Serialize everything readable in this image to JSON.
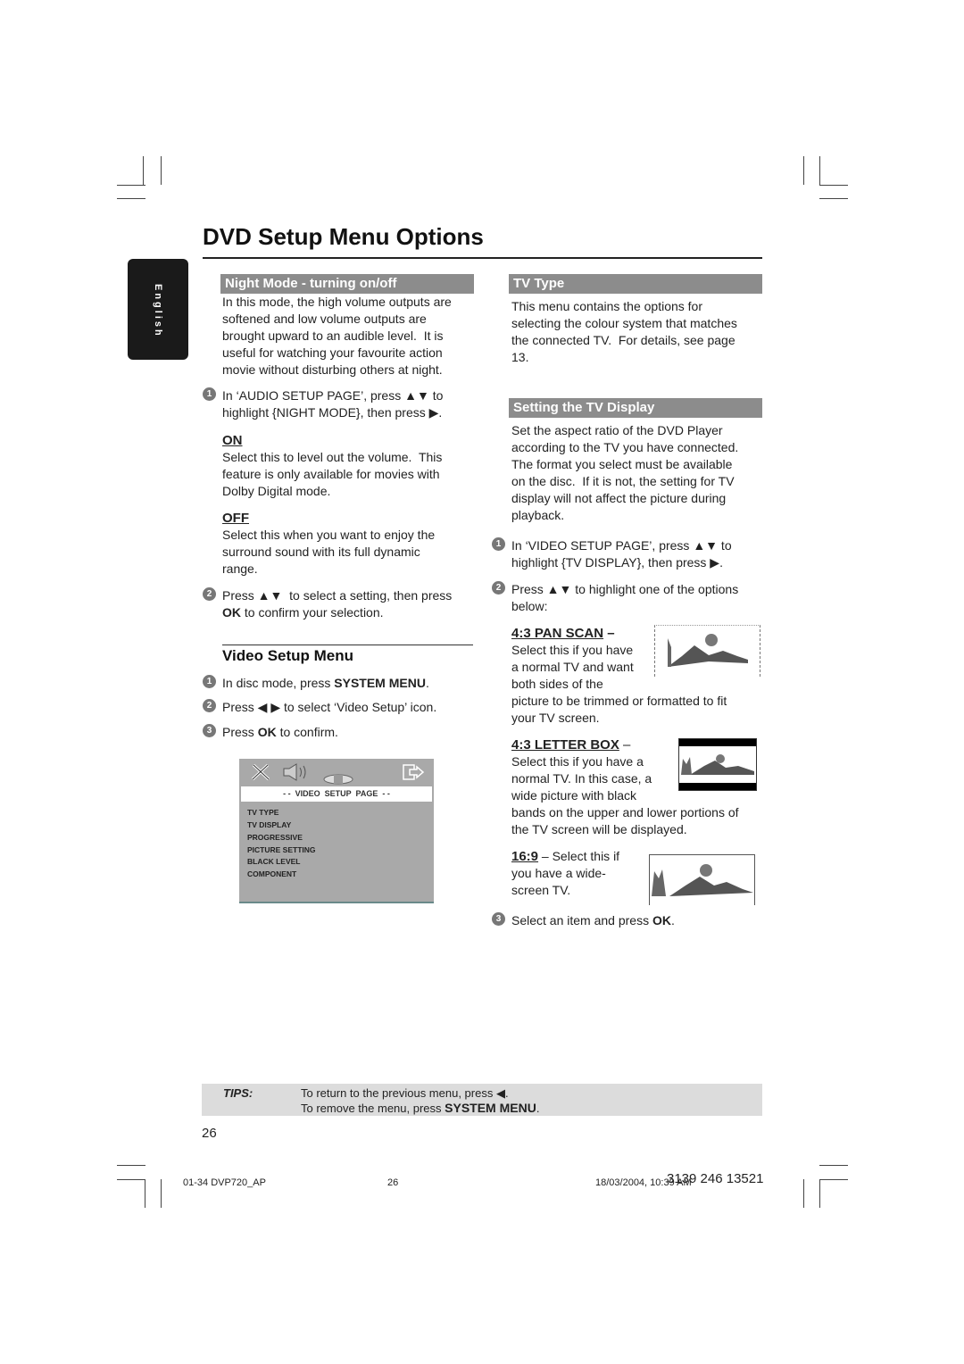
{
  "title": "DVD Setup Menu Options",
  "language_tab": "English",
  "left": {
    "night_mode": {
      "header": "Night Mode - turning on/off",
      "intro": "In this mode, the high volume outputs are\nsoftened and low volume outputs are\nbrought upward to an audible level.  It is\nuseful for watching your favourite action\nmovie without disturbing others at night.",
      "step1": {
        "num": "1",
        "text": "In ‘AUDIO SETUP PAGE’, press ▲▼ to\nhighlight {NIGHT MODE}, then press ▶."
      },
      "on": {
        "label": "ON",
        "text": "Select this to level out the volume.  This\nfeature is only available for movies with\nDolby Digital mode."
      },
      "off": {
        "label": "OFF",
        "text": "Select this when you want to enjoy the\nsurround sound with its full dynamic\nrange."
      },
      "step2": {
        "num": "2",
        "line1": "Press ▲▼  to select a setting, then press",
        "bold": "OK",
        "line2_rest": " to confirm your selection."
      }
    },
    "video_setup": {
      "heading": "Video Setup Menu",
      "step1": {
        "num": "1",
        "pre": "In disc mode, press ",
        "bold": "SYSTEM MENU",
        "post": "."
      },
      "step2": {
        "num": "2",
        "text": "Press ◀ ▶ to select ‘Video Setup’ icon."
      },
      "step3": {
        "num": "3",
        "pre": "Press ",
        "bold": "OK",
        "post": " to confirm."
      }
    },
    "menu_screen": {
      "header": "- -  VIDEO  SETUP  PAGE  - -",
      "items": [
        "TV TYPE",
        "TV DISPLAY",
        "PROGRESSIVE",
        "PICTURE SETTING",
        "BLACK LEVEL",
        "COMPONENT"
      ],
      "icons": [
        "tools-icon",
        "speaker-icon",
        "disc-icon",
        "exit-icon"
      ]
    }
  },
  "right": {
    "tv_type": {
      "header": "TV Type",
      "text": "This menu contains the options for\nselecting the colour system that matches\nthe connected TV.  For details, see page\n13."
    },
    "tv_display": {
      "header": "Setting the TV Display",
      "intro": "Set the aspect ratio of the DVD Player\naccording to the TV you have connected.\nThe format you select must be available\non the disc.  If it is not, the setting for TV\ndisplay will not affect the picture during\nplayback.",
      "step1": {
        "num": "1",
        "text": "In ‘VIDEO SETUP PAGE’, press ▲▼ to\nhighlight {TV DISPLAY}, then press ▶."
      },
      "step2": {
        "num": "2",
        "text": "Press ▲▼ to highlight one of the options\nbelow:"
      },
      "pan_scan": {
        "label": "4:3 PAN SCAN",
        "dash": " –",
        "text_narrow": "Select this if you have\na normal TV and want\nboth sides of the",
        "text_wide": "picture to be trimmed or formatted to fit\nyour TV screen."
      },
      "letter_box": {
        "label": "4:3 LETTER BOX",
        "dash": " –",
        "text_narrow": "Select this if you have a\nnormal TV. In this case, a\nwide picture with black",
        "text_wide": "bands on the upper and lower portions of\nthe TV screen will be displayed."
      },
      "wide": {
        "label": "16:9",
        "rest": " – Select this if",
        "text": "you have a wide-\nscreen TV."
      },
      "step3": {
        "num": "3",
        "pre": "Select an item and press ",
        "bold": "OK",
        "post": "."
      }
    }
  },
  "tips": {
    "label": "TIPS:",
    "line1": "To return to the previous menu, press ◀.",
    "line2_pre": "To remove the menu, press ",
    "line2_bold": "SYSTEM MENU",
    "line2_post": "."
  },
  "page_number": "26",
  "footer": {
    "file": "01-34 DVP720_AP",
    "page": "26",
    "date": "18/03/2004, 10:39 AM",
    "code": "3139 246 13521"
  },
  "colors": {
    "bar": "#8c8c8c",
    "tab": "#1a1a1a",
    "tips_bg": "#dcdcdc",
    "menu_bg": "#a9a9a9"
  }
}
